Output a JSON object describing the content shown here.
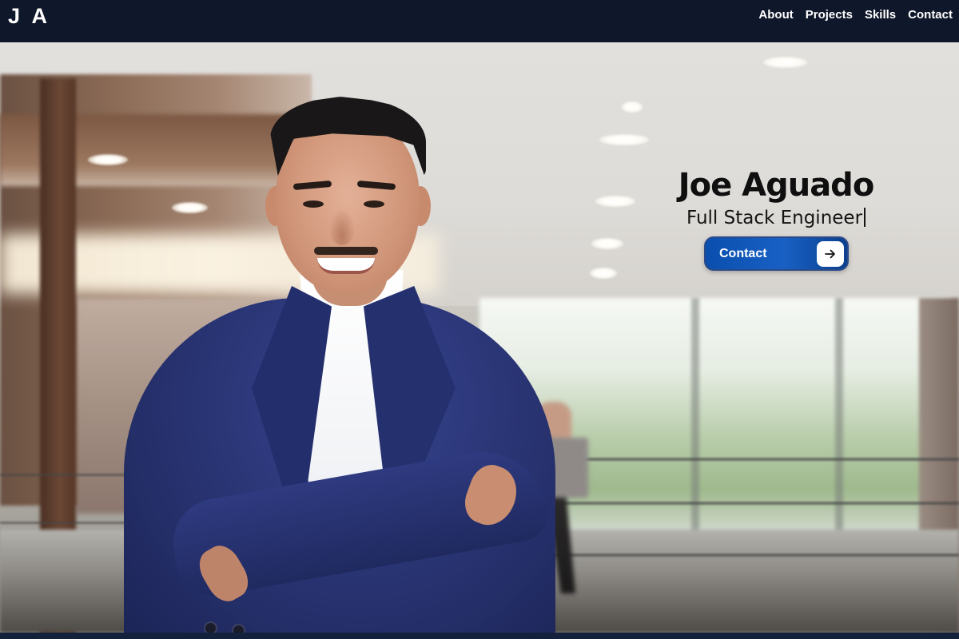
{
  "nav": {
    "logo": "J A",
    "links": [
      "About",
      "Projects",
      "Skills",
      "Contact"
    ]
  },
  "hero": {
    "name": "Joe Aguado",
    "role": "Full Stack Engineer",
    "contact_label": "Contact",
    "contact_icon": "arrow-right-icon"
  },
  "colors": {
    "nav_background": "#0f172a",
    "accent": "#0a4fae",
    "text_dark": "#0f0f10"
  }
}
